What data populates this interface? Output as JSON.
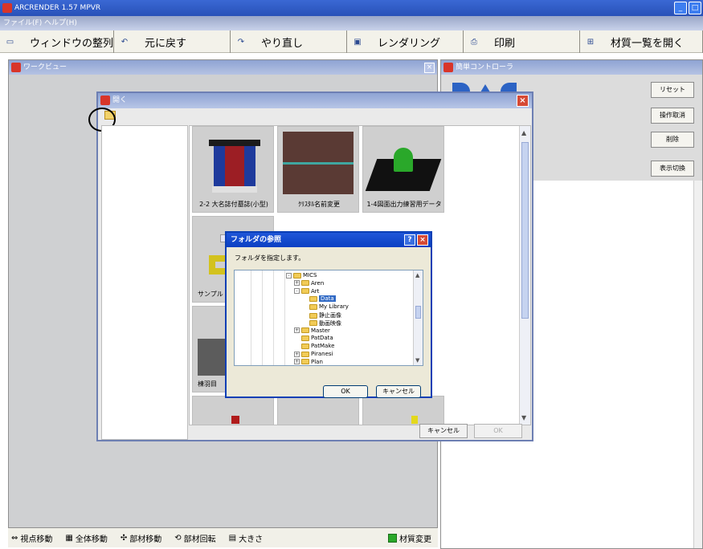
{
  "app": {
    "title": "ARCRENDER 1.57 MPVR"
  },
  "menu": {
    "text": "ファイル(F)  ヘルプ(H)"
  },
  "toolbar": [
    {
      "label": "ウィンドウの整列",
      "icon": "window-icon",
      "w": 142
    },
    {
      "label": "元に戻す",
      "icon": "undo-icon",
      "w": 145
    },
    {
      "label": "やり直し",
      "icon": "redo-icon",
      "w": 145
    },
    {
      "label": "レンダリング",
      "icon": "render-icon",
      "w": 145
    },
    {
      "label": "印刷",
      "icon": "print-icon",
      "w": 145
    },
    {
      "label": "材質一覧を開く",
      "icon": "material-list-icon",
      "w": 153
    }
  ],
  "work_panel": {
    "title": "ワークビュー"
  },
  "control_panel": {
    "title": "簡単コントローラ",
    "buttons": [
      "リセット",
      "操作取消",
      "削除",
      "表示切換"
    ]
  },
  "status_bar": {
    "items": [
      "視点移動",
      "全体移動",
      "部材移動",
      "部材回転",
      "大きさ"
    ],
    "material_change": "材質変更"
  },
  "material_dialog": {
    "title": "開く",
    "thumbnails": [
      {
        "caption": "2-2 大名誌付墓誌(小型)"
      },
      {
        "caption": "ｸﾘｽﾀﾙ名前変更"
      },
      {
        "caption": "1-4図面出力練習用データ"
      },
      {
        "caption": "サンプル"
      },
      {
        "caption": "棟羽目"
      }
    ],
    "cancel_label": "キャンセル",
    "ok_label": "OK"
  },
  "folder_dialog": {
    "title": "フォルダの参照",
    "prompt": "フォルダを指定します。",
    "tree": [
      {
        "label": "MICS",
        "expander": "-",
        "level": 0
      },
      {
        "label": "Aren",
        "expander": "+",
        "level": 1
      },
      {
        "label": "Art",
        "expander": "-",
        "level": 1
      },
      {
        "label": "Data",
        "expander": "",
        "level": 2,
        "selected": true
      },
      {
        "label": "My Library",
        "expander": "",
        "level": 2
      },
      {
        "label": "静止画像",
        "expander": "",
        "level": 2
      },
      {
        "label": "動画映像",
        "expander": "",
        "level": 2
      },
      {
        "label": "Master",
        "expander": "+",
        "level": 1
      },
      {
        "label": "PatData",
        "expander": "",
        "level": 1
      },
      {
        "label": "PatMake",
        "expander": "",
        "level": 1
      },
      {
        "label": "Piranesi",
        "expander": "+",
        "level": 1
      },
      {
        "label": "Plan",
        "expander": "+",
        "level": 1
      }
    ],
    "ok_label": "OK",
    "cancel_label": "キャンセル"
  }
}
